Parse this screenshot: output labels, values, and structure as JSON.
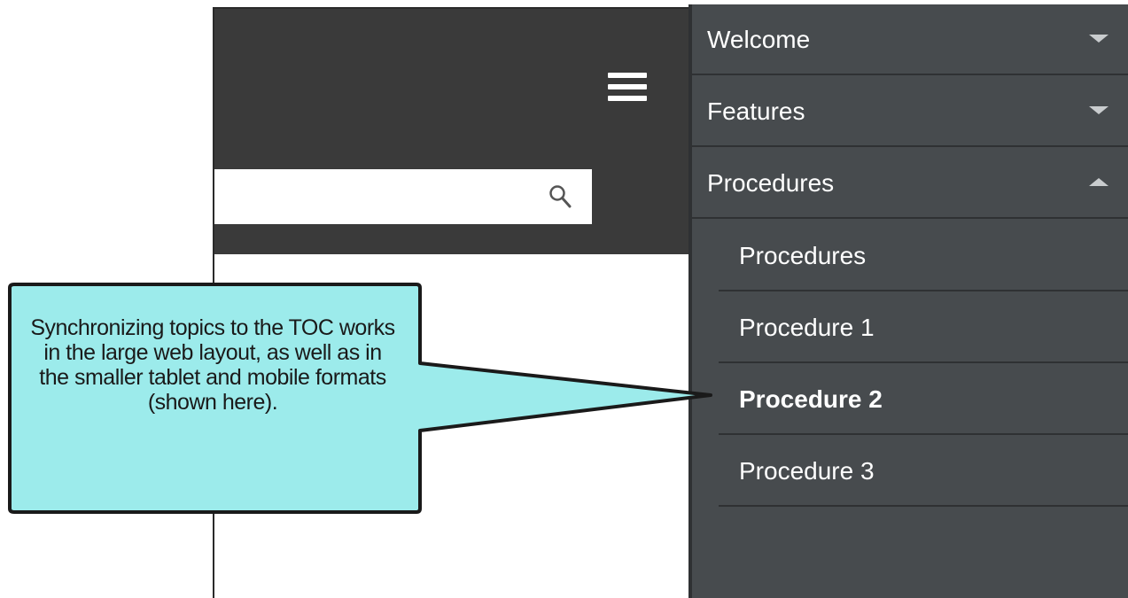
{
  "search": {
    "value": "",
    "placeholder": ""
  },
  "toc": {
    "items": [
      {
        "label": "Welcome",
        "state": "collapsed"
      },
      {
        "label": "Features",
        "state": "collapsed"
      },
      {
        "label": "Procedures",
        "state": "expanded"
      }
    ],
    "subitems": [
      {
        "label": "Procedures",
        "active": false
      },
      {
        "label": "Procedure 1",
        "active": false
      },
      {
        "label": "Procedure 2",
        "active": true
      },
      {
        "label": "Procedure 3",
        "active": false
      }
    ]
  },
  "callout": {
    "text": "Synchronizing topics to the TOC works in the large web layout, as well as in the smaller tablet and mobile formats (shown here).",
    "fill": "#9cebeb",
    "stroke": "#1a1a1a"
  },
  "colors": {
    "header": "#3a3a3a",
    "toc_bg": "#474b4e",
    "toc_divider": "#2f3133"
  },
  "icons": {
    "menu": "hamburger-menu-icon",
    "search": "search-icon",
    "collapsed": "chevron-down-icon",
    "expanded": "chevron-up-icon"
  }
}
